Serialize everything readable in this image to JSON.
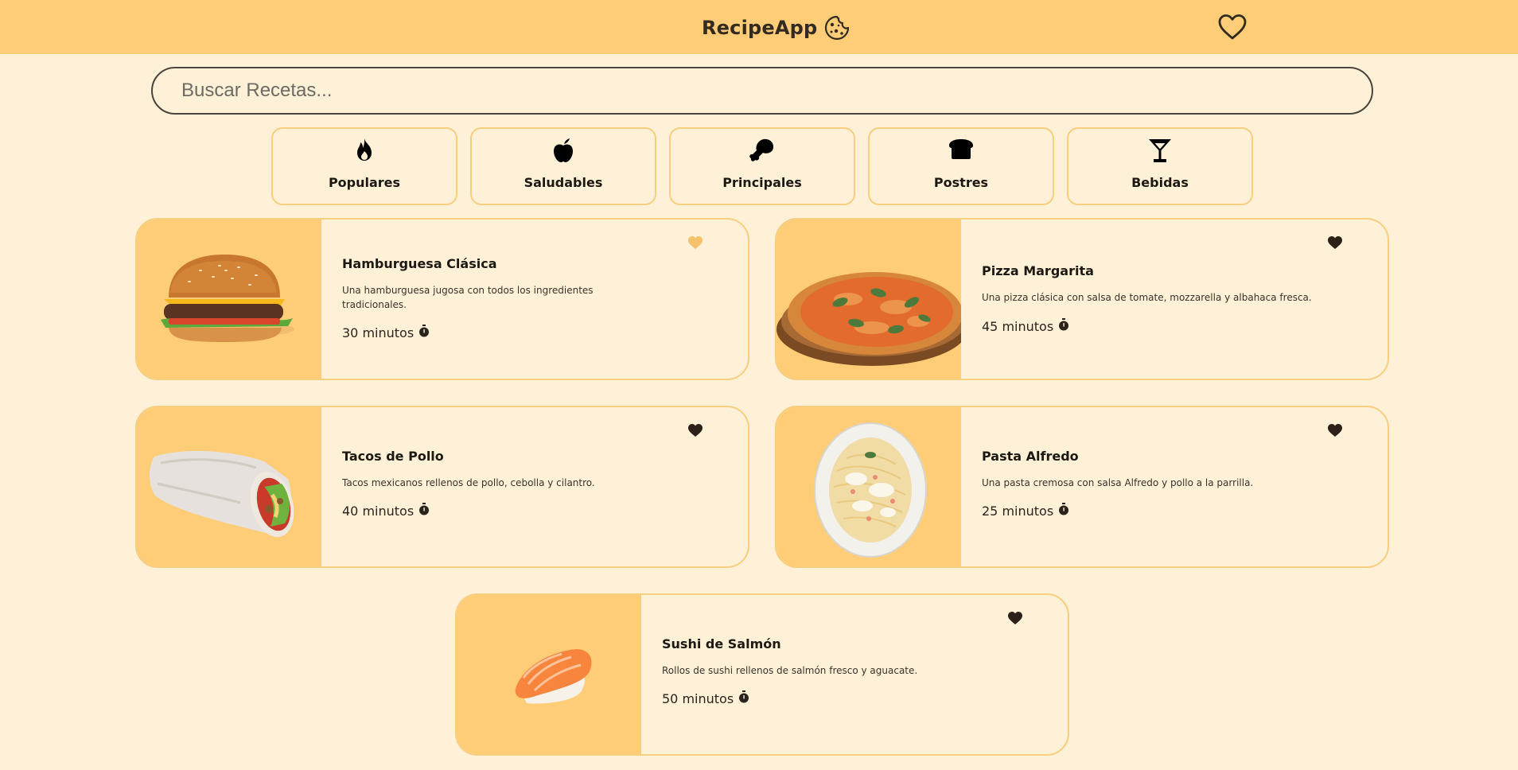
{
  "header": {
    "app_name": "RecipeApp",
    "logo_icon": "cookie-icon",
    "favorites_icon": "heart-outline-icon",
    "background_color": "#ffcc77"
  },
  "search": {
    "placeholder": "Buscar Recetas...",
    "value": ""
  },
  "categories": [
    {
      "label": "Populares",
      "icon": "fire-icon"
    },
    {
      "label": "Saludables",
      "icon": "apple-icon"
    },
    {
      "label": "Principales",
      "icon": "drumstick-icon"
    },
    {
      "label": "Postres",
      "icon": "bread-icon"
    },
    {
      "label": "Bebidas",
      "icon": "cocktail-icon"
    }
  ],
  "recipes": [
    {
      "title": "Hamburguesa Clásica",
      "description": "Una hamburguesa jugosa con todos los ingredientes tradicionales.",
      "time": "30 minutos",
      "image": "hamburger-image",
      "favorite_icon_color": "#f7c06a"
    },
    {
      "title": "Pizza Margarita",
      "description": "Una pizza clásica con salsa de tomate, mozzarella y albahaca fresca.",
      "time": "45 minutos",
      "image": "pizza-image",
      "favorite_icon_color": "#2b2118"
    },
    {
      "title": "Tacos de Pollo",
      "description": "Tacos mexicanos rellenos de pollo, cebolla y cilantro.",
      "time": "40 minutos",
      "image": "wrap-image",
      "favorite_icon_color": "#2b2118"
    },
    {
      "title": "Pasta Alfredo",
      "description": "Una pasta cremosa con salsa Alfredo y pollo a la parrilla.",
      "time": "25 minutos",
      "image": "pasta-image",
      "favorite_icon_color": "#2b2118"
    },
    {
      "title": "Sushi de Salmón",
      "description": "Rollos de sushi rellenos de salmón fresco y aguacate.",
      "time": "50 minutos",
      "image": "sushi-image",
      "favorite_icon_color": "#2b2118"
    }
  ],
  "colors": {
    "page_background": "#fff1d7",
    "accent": "#ffcc77",
    "card_border": "#f7cd7f",
    "text": "#1c1812"
  }
}
